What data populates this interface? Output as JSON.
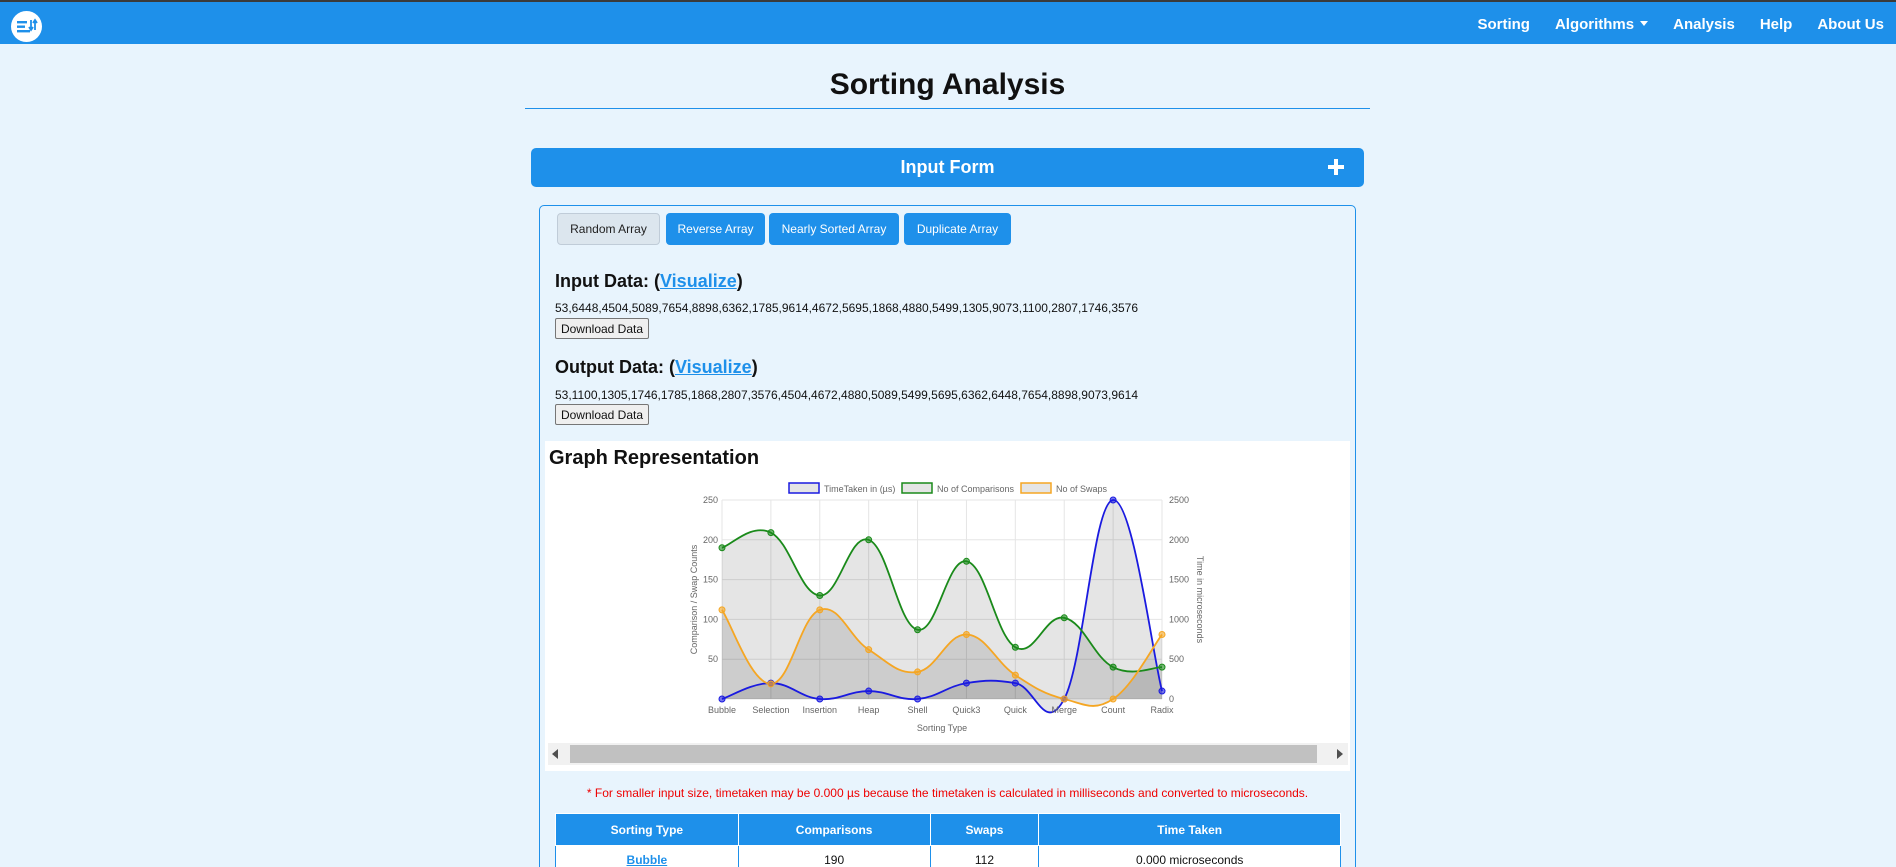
{
  "nav": {
    "logo": "sorting-logo-icon",
    "items": [
      "Sorting",
      "Algorithms",
      "Analysis",
      "Help",
      "About Us"
    ]
  },
  "page": {
    "title": "Sorting Analysis"
  },
  "form": {
    "header": "Input Form",
    "toggle_icon": "plus-icon"
  },
  "tabs": [
    "Random Array",
    "Reverse Array",
    "Nearly Sorted Array",
    "Duplicate Array"
  ],
  "input": {
    "heading": "Input Data:",
    "link": "Visualize",
    "data": "53,6448,4504,5089,7654,8898,6362,1785,9614,4672,5695,1868,4880,5499,1305,9073,1100,2807,1746,3576",
    "download": "Download Data"
  },
  "output": {
    "heading": "Output Data:",
    "link": "Visualize",
    "data": "53,1100,1305,1746,1785,1868,2807,3576,4504,4672,4880,5089,5499,5695,6362,6448,7654,8898,9073,9614",
    "download": "Download Data"
  },
  "graph": {
    "heading": "Graph Representation"
  },
  "chart_data": {
    "type": "line",
    "categories": [
      "Bubble",
      "Selection",
      "Insertion",
      "Heap",
      "Shell",
      "Quick3",
      "Quick",
      "Merge",
      "Count",
      "Radix"
    ],
    "series": [
      {
        "name": "TimeTaken in (µs)",
        "axis": "right",
        "color": "#1a1ae0",
        "values": [
          0,
          200,
          0,
          100,
          0,
          200,
          200,
          0,
          2500,
          100
        ]
      },
      {
        "name": "No of Comparisons",
        "axis": "left",
        "color": "#1a8a1a",
        "values": [
          190,
          209,
          130,
          200,
          87,
          173,
          65,
          102,
          40,
          40
        ]
      },
      {
        "name": "No of Swaps",
        "axis": "left",
        "color": "#f5a623",
        "values": [
          112,
          19,
          112,
          62,
          34,
          81,
          30,
          0,
          0,
          81
        ]
      }
    ],
    "xlabel": "Sorting Type",
    "ylabel": "Comparison / Swap Counts",
    "y2label": "Time in microseconds",
    "ylim": [
      0,
      250
    ],
    "y2lim": [
      0,
      2500
    ],
    "yticks": [
      50,
      100,
      150,
      200,
      250
    ],
    "y2ticks": [
      0,
      500,
      1000,
      1500,
      2000,
      2500
    ],
    "legend": "top",
    "grid": true
  },
  "note": "* For smaller input size, timetaken may be 0.000 µs because the timetaken is calculated in milliseconds and converted to microseconds.",
  "table": {
    "headers": [
      "Sorting Type",
      "Comparisons",
      "Swaps",
      "Time Taken"
    ],
    "rows": [
      [
        "Bubble",
        "190",
        "112",
        "0.000 microseconds"
      ]
    ]
  }
}
